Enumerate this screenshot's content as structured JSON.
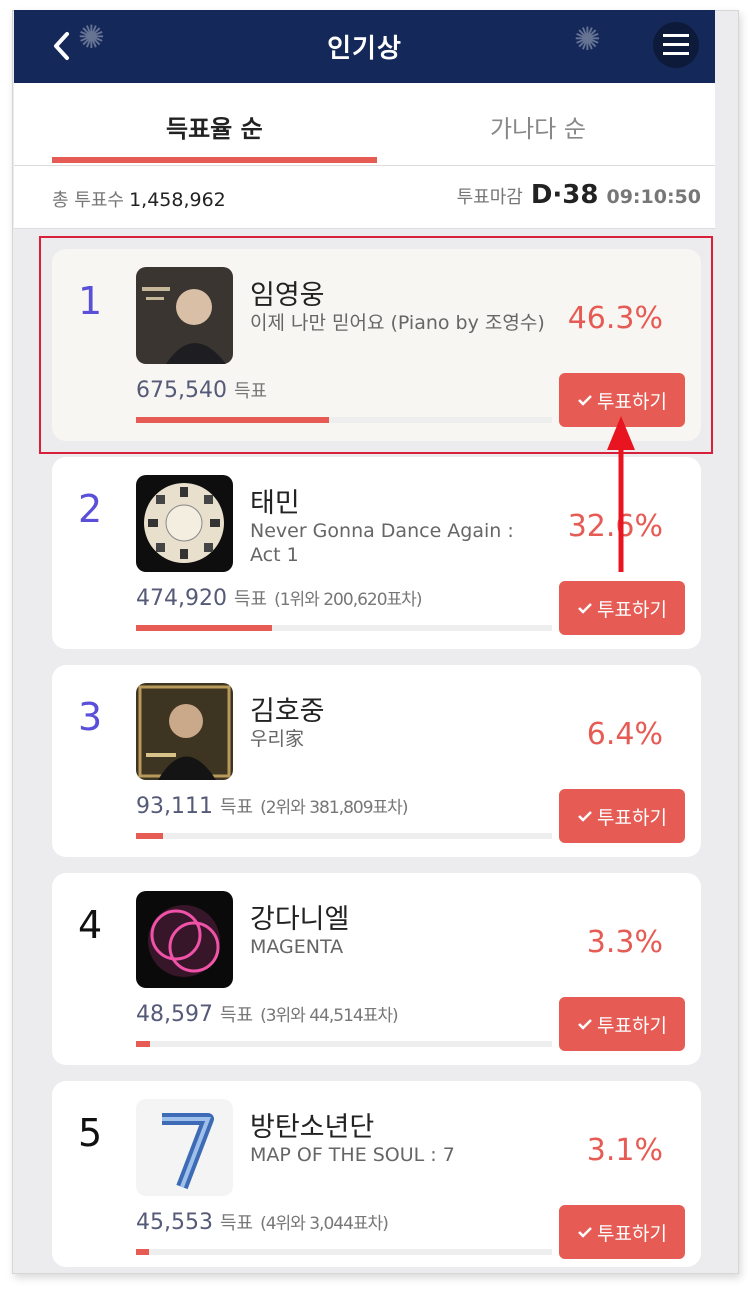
{
  "header": {
    "title": "인기상",
    "back_icon": "chevron-left-icon",
    "menu_icon": "hamburger-menu-icon"
  },
  "tabs": [
    {
      "label": "득표율 순",
      "active": true
    },
    {
      "label": "가나다 순",
      "active": false
    }
  ],
  "summary": {
    "total_label": "총 투표수",
    "total_value": "1,458,962",
    "deadline_label": "투표마감",
    "dday": "D·38",
    "time": "09:10:50"
  },
  "vote_button_label": "투표하기",
  "vote_unit": "득표",
  "colors": {
    "accent": "#e65b54",
    "header_bg": "#14285a",
    "rank_top": "#5a4fd8",
    "highlight": "#d8203a"
  },
  "entries": [
    {
      "rank": "1",
      "artist": "임영웅",
      "song": "이제 나만 믿어요 (Piano by 조영수)",
      "percent": "46.3%",
      "votes": "675,540",
      "diff": "",
      "share": 0.463
    },
    {
      "rank": "2",
      "artist": "태민",
      "song": "Never Gonna Dance Again : Act 1",
      "percent": "32.6%",
      "votes": "474,920",
      "diff": "(1위와 200,620표차)",
      "share": 0.326
    },
    {
      "rank": "3",
      "artist": "김호중",
      "song": "우리家",
      "percent": "6.4%",
      "votes": "93,111",
      "diff": "(2위와 381,809표차)",
      "share": 0.064
    },
    {
      "rank": "4",
      "artist": "강다니엘",
      "song": "MAGENTA",
      "percent": "3.3%",
      "votes": "48,597",
      "diff": "(3위와 44,514표차)",
      "share": 0.033
    },
    {
      "rank": "5",
      "artist": "방탄소년단",
      "song": "MAP OF THE SOUL : 7",
      "percent": "3.1%",
      "votes": "45,553",
      "diff": "(4위와 3,044표차)",
      "share": 0.031
    }
  ]
}
